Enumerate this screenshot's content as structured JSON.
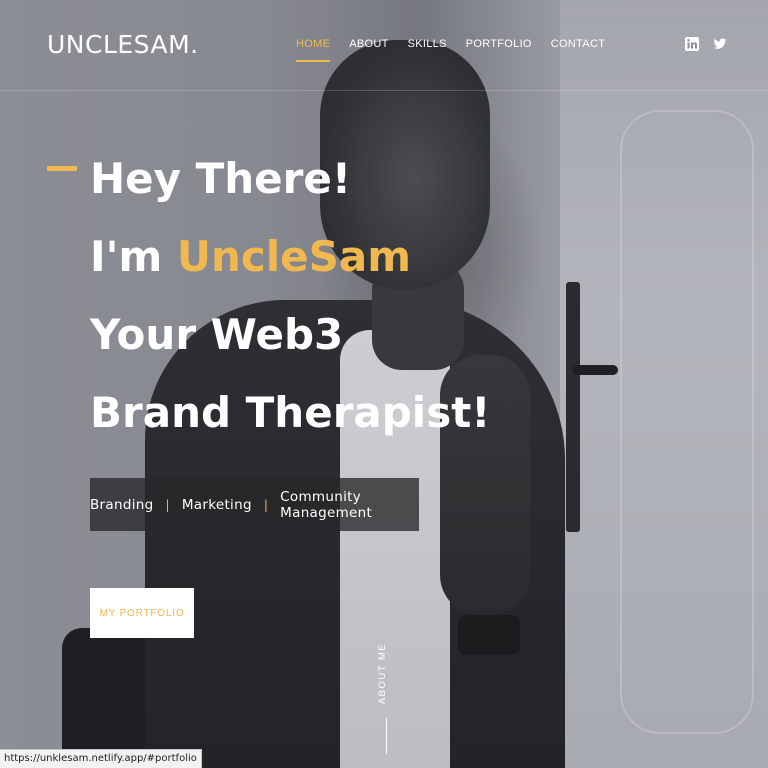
{
  "header": {
    "logo": "UNCLESAM.",
    "nav": [
      {
        "label": "HOME",
        "active": true
      },
      {
        "label": "ABOUT",
        "active": false
      },
      {
        "label": "SKILLS",
        "active": false
      },
      {
        "label": "PORTFOLIO",
        "active": false
      },
      {
        "label": "CONTACT",
        "active": false
      }
    ],
    "social": [
      "linkedin-icon",
      "twitter-icon"
    ]
  },
  "hero": {
    "line1": "Hey There!",
    "line2_prefix": "I'm ",
    "line2_name": "UncleSam",
    "line3": "Your Web3",
    "line4": "Brand Therapist!"
  },
  "services": {
    "items": [
      "Branding",
      "Marketing",
      "Community Management"
    ],
    "separator": "|"
  },
  "cta": {
    "label": "MY PORTFOLIO"
  },
  "scroll_hint": {
    "label": "ABOUT ME"
  },
  "status_bar": {
    "url": "https://unklesam.netlify.app/#portfolio"
  },
  "colors": {
    "accent": "#f0b84f",
    "text": "#ffffff"
  }
}
